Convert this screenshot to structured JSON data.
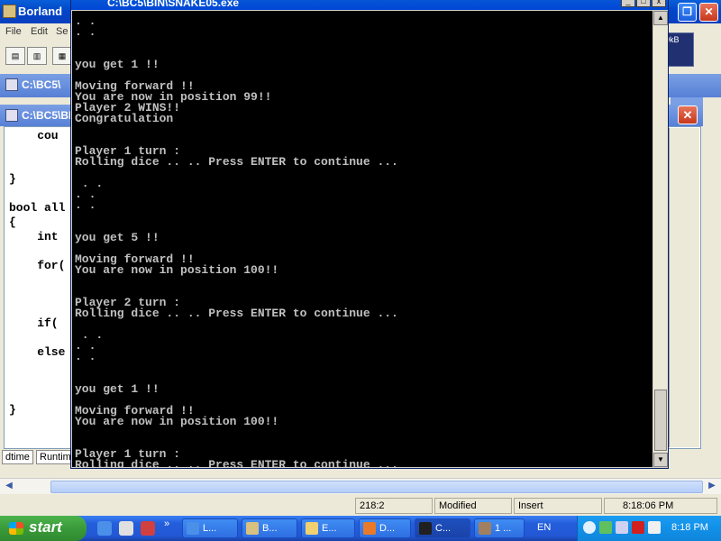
{
  "ide": {
    "title": "Borland",
    "menu": [
      "File",
      "Edit",
      "Se"
    ],
    "window1_title": "C:\\BC5\\",
    "window2_title": "C:\\BC5\\BIN",
    "code_lines": [
      "    cou",
      "",
      "}",
      "",
      "bool all",
      "{",
      "    int ",
      "",
      "    for(",
      "        ",
      "",
      "    if(",
      "",
      "    else",
      "",
      "",
      "}"
    ],
    "tabs": [
      "dtime",
      "Runtim"
    ],
    "status": {
      "position": "218:2",
      "modified": "Modified",
      "mode": "Insert",
      "time": "8:18:06 PM"
    },
    "net_monitor": "10kB"
  },
  "console": {
    "title": "C:\\BC5\\BIN\\SNAKE05.exe",
    "lines": [
      ". .",
      ". .",
      "",
      "",
      "you get 1 !!",
      "",
      "Moving forward !!",
      "You are now in position 99!!",
      "Player 2 WINS!!",
      "Congratulation",
      "",
      "",
      "Player 1 turn :",
      "Rolling dice .. .. Press ENTER to continue ...",
      "",
      " . .",
      ". .",
      ". .",
      "",
      "",
      "you get 5 !!",
      "",
      "Moving forward !!",
      "You are now in position 100!!",
      "",
      "",
      "Player 2 turn :",
      "Rolling dice .. .. Press ENTER to continue ...",
      "",
      " . .",
      ". .",
      ". .",
      "",
      "",
      "you get 1 !!",
      "",
      "Moving forward !!",
      "You are now in position 100!!",
      "",
      "",
      "Player 1 turn :",
      "Rolling dice .. .. Press ENTER to continue ..."
    ]
  },
  "taskbar": {
    "start_label": "start",
    "tasks": [
      {
        "label": "L...",
        "icon": "browser-icon",
        "color": "#4a8fe8"
      },
      {
        "label": "B...",
        "icon": "borland-icon",
        "color": "#d8c080"
      },
      {
        "label": "E...",
        "icon": "explorer-icon",
        "color": "#f0d070"
      },
      {
        "label": "D...",
        "icon": "firefox-icon",
        "color": "#e87a2a"
      },
      {
        "label": "C...",
        "icon": "console-icon",
        "color": "#202020"
      },
      {
        "label": "1 ...",
        "icon": "app-icon",
        "color": "#a08060"
      }
    ],
    "language": "EN",
    "clock": "8:18 PM"
  }
}
